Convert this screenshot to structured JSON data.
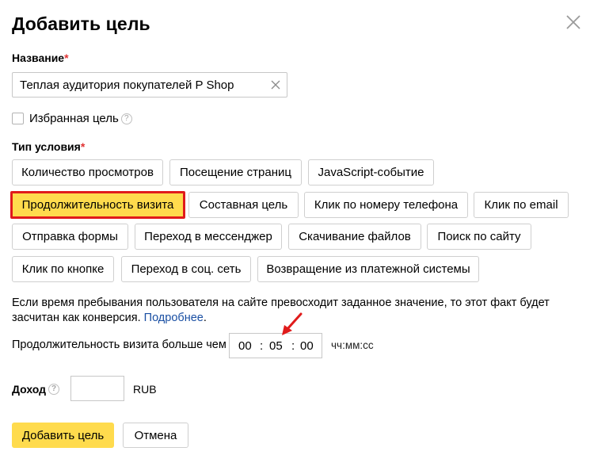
{
  "dialog": {
    "title": "Добавить цель",
    "close_icon": "close-icon"
  },
  "name_field": {
    "label": "Название",
    "required_mark": "*",
    "value": "Теплая аудитория покупателей P Shop",
    "clear_icon": "clear-icon"
  },
  "favorite": {
    "label": "Избранная цель",
    "checked": false,
    "help": "?"
  },
  "condition": {
    "label": "Тип условия",
    "required_mark": "*",
    "options": [
      {
        "label": "Количество просмотров",
        "selected": false
      },
      {
        "label": "Посещение страниц",
        "selected": false
      },
      {
        "label": "JavaScript-событие",
        "selected": false
      },
      {
        "label": "Продолжительность визита",
        "selected": true
      },
      {
        "label": "Составная цель",
        "selected": false
      },
      {
        "label": "Клик по номеру телефона",
        "selected": false
      },
      {
        "label": "Клик по email",
        "selected": false
      },
      {
        "label": "Отправка формы",
        "selected": false
      },
      {
        "label": "Переход в мессенджер",
        "selected": false
      },
      {
        "label": "Скачивание файлов",
        "selected": false
      },
      {
        "label": "Поиск по сайту",
        "selected": false
      },
      {
        "label": "Клик по кнопке",
        "selected": false
      },
      {
        "label": "Переход в соц. сеть",
        "selected": false
      },
      {
        "label": "Возвращение из платежной системы",
        "selected": false
      }
    ]
  },
  "info": {
    "text": "Если время пребывания пользователя на сайте превосходит заданное значение, то этот факт будет засчитан как конверсия.",
    "link": "Подробнее",
    "end": "."
  },
  "duration": {
    "label": "Продолжительность визита больше чем",
    "hours": "00",
    "minutes": "05",
    "seconds": "00",
    "separator": ":",
    "format": "чч:мм:сс",
    "annotation_color": "#e01b1b"
  },
  "income": {
    "label": "Доход",
    "help": "?",
    "value": "",
    "currency": "RUB"
  },
  "actions": {
    "submit": "Добавить цель",
    "cancel": "Отмена"
  },
  "colors": {
    "accent": "#ffdb4d",
    "highlight_border": "#e01b1b",
    "link": "#1a4fa3"
  }
}
